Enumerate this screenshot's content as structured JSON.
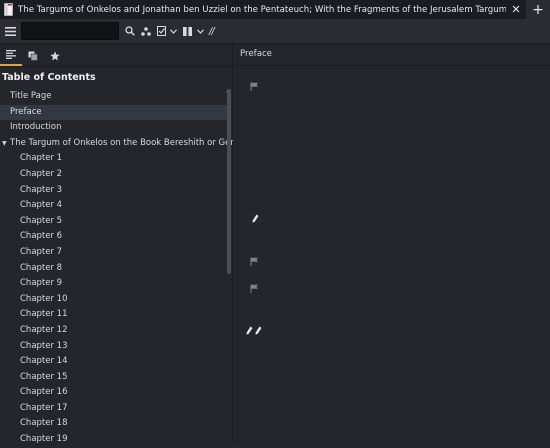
{
  "window": {
    "title": "The Targums of Onkelos and Jonathan ben Uzziel on the Pentateuch; With the Fragments of the Jerusalem Targum: From the Chaldee",
    "close_label": "✕",
    "add_label": "+"
  },
  "toolbar": {
    "search_value": "",
    "icons": [
      "menu-icon",
      "search-icon",
      "annotations-icon",
      "bookmark-icon",
      "chevron-down-icon",
      "columns-icon",
      "chevron-down-icon",
      "slash-icon"
    ],
    "slash_label": "//"
  },
  "sidebar": {
    "tabs": [
      "contents-tab",
      "annotations-tab",
      "bookmarks-tab"
    ],
    "heading": "Table of Contents",
    "items": [
      {
        "label": "Title Page"
      },
      {
        "label": "Preface"
      },
      {
        "label": "Introduction"
      },
      {
        "label": "The Targum of Onkelos on the Book Bereshith or Genesis"
      },
      {
        "label": "Chapter 1"
      },
      {
        "label": "Chapter 2"
      },
      {
        "label": "Chapter 3"
      },
      {
        "label": "Chapter 4"
      },
      {
        "label": "Chapter 5"
      },
      {
        "label": "Chapter 6"
      },
      {
        "label": "Chapter 7"
      },
      {
        "label": "Chapter 8"
      },
      {
        "label": "Chapter 9"
      },
      {
        "label": "Chapter 10"
      },
      {
        "label": "Chapter 11"
      },
      {
        "label": "Chapter 12"
      },
      {
        "label": "Chapter 13"
      },
      {
        "label": "Chapter 14"
      },
      {
        "label": "Chapter 15"
      },
      {
        "label": "Chapter 16"
      },
      {
        "label": "Chapter 17"
      },
      {
        "label": "Chapter 18"
      },
      {
        "label": "Chapter 19"
      }
    ]
  },
  "content": {
    "header": "Preface"
  },
  "colors": {
    "background": "#24262c",
    "titlebar": "#1b1c21",
    "accent": "#e2a53a",
    "selected": "#353842"
  }
}
